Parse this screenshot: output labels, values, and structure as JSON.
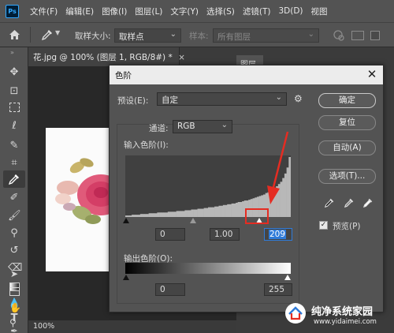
{
  "app": {
    "logo": "Ps",
    "menu": [
      "文件(F)",
      "编辑(E)",
      "图像(I)",
      "图层(L)",
      "文字(Y)",
      "选择(S)",
      "滤镜(T)",
      "3D(D)",
      "视图"
    ]
  },
  "options_bar": {
    "sample_size_label": "取样大小:",
    "sample_size_value": "取样点",
    "sample_label": "样本:",
    "sample_value": "所有图层"
  },
  "document": {
    "tab_title": "花.jpg @ 100% (图层 1, RGB/8#) *",
    "tab_close": "×",
    "zoom": "100%"
  },
  "panels": {
    "layers_tab": "图层"
  },
  "levels_dialog": {
    "title": "色阶",
    "preset_label": "预设(E):",
    "preset_value": "自定",
    "channel_label": "通道:",
    "channel_value": "RGB",
    "input_levels_label": "输入色阶(I):",
    "input_black": "0",
    "input_gamma": "1.00",
    "input_white": "209",
    "output_levels_label": "输出色阶(O):",
    "output_black": "0",
    "output_white": "255",
    "buttons": {
      "ok": "确定",
      "reset": "复位",
      "auto": "自动(A)",
      "options": "选项(T)..."
    },
    "preview_label": "预览(P)",
    "preview_checked": true,
    "histogram": [
      2,
      2,
      2,
      3,
      3,
      3,
      3,
      4,
      4,
      4,
      4,
      5,
      5,
      5,
      5,
      6,
      6,
      6,
      6,
      6,
      7,
      7,
      7,
      7,
      8,
      8,
      8,
      8,
      9,
      9,
      9,
      10,
      10,
      10,
      11,
      11,
      11,
      12,
      12,
      13,
      13,
      13,
      14,
      14,
      15,
      15,
      16,
      16,
      17,
      17,
      18,
      18,
      19,
      20,
      20,
      21,
      22,
      22,
      23,
      24,
      25,
      26,
      27,
      28,
      29,
      30,
      32,
      33,
      35,
      36,
      38,
      41,
      44,
      47,
      52,
      58,
      66,
      80
    ]
  },
  "watermark": {
    "title": "纯净系统家园",
    "url": "www.yidaimei.com"
  },
  "colors": {
    "annotation_red": "#e52c22",
    "accent_blue": "#2f7bd9"
  }
}
